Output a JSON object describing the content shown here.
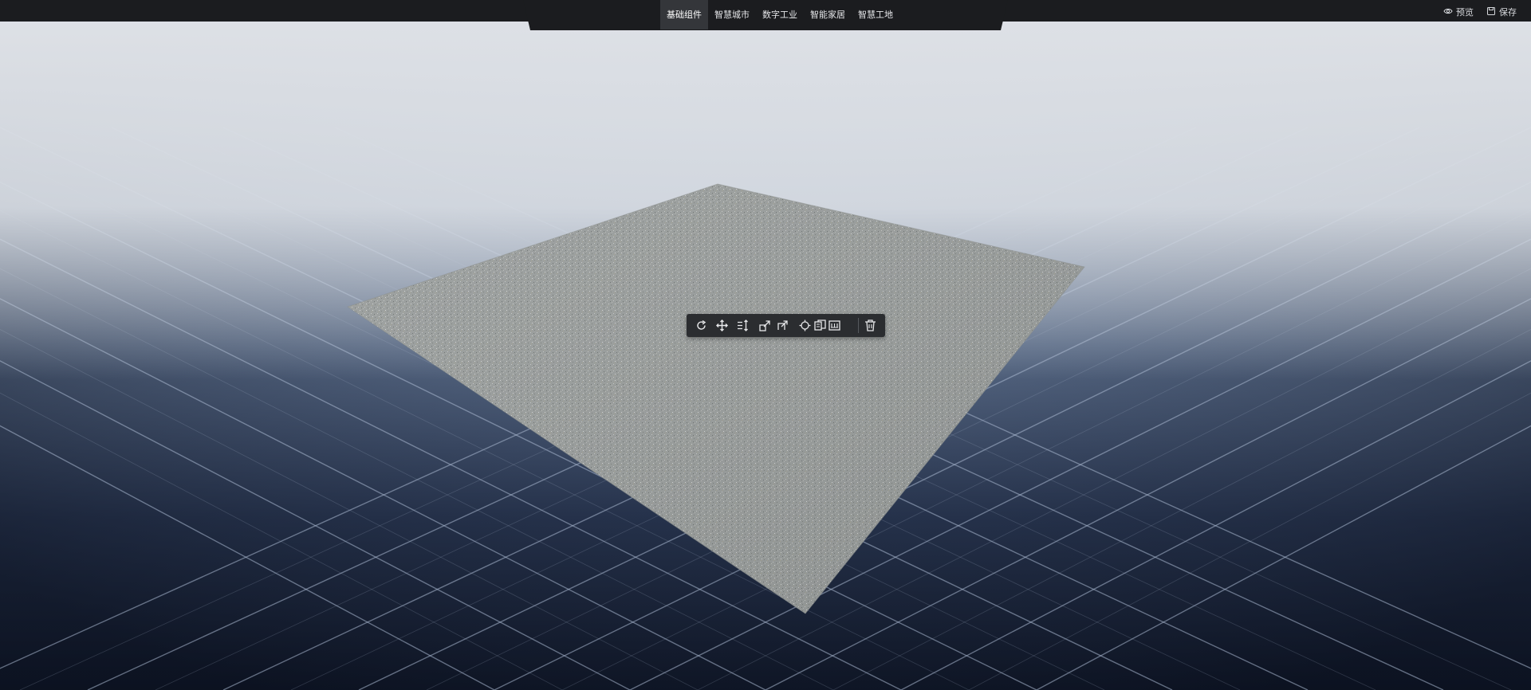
{
  "header": {
    "tabs": [
      {
        "label": "基础组件",
        "active": true
      },
      {
        "label": "智慧城市",
        "active": false
      },
      {
        "label": "数字工业",
        "active": false
      },
      {
        "label": "智能家居",
        "active": false
      },
      {
        "label": "智慧工地",
        "active": false
      }
    ],
    "preview_label": "预览",
    "save_label": "保存",
    "preview_icon": "eye-icon",
    "save_icon": "floppy-disk-icon"
  },
  "toolbar": {
    "tools": [
      "rotate-icon",
      "move-icon",
      "vertical-scale-icon",
      "scale-icon",
      "scale-alt-icon",
      "focus-icon",
      "copy-icon",
      "frame-icon",
      "delete-icon"
    ]
  },
  "colors": {
    "topbar": "#1b1c1f",
    "active_tab": "#34363a",
    "toolbar": "#2b2d30",
    "grid_line": "#aab8cf",
    "sky": "#d6dbe2",
    "ground_dark": "#0d1424"
  }
}
